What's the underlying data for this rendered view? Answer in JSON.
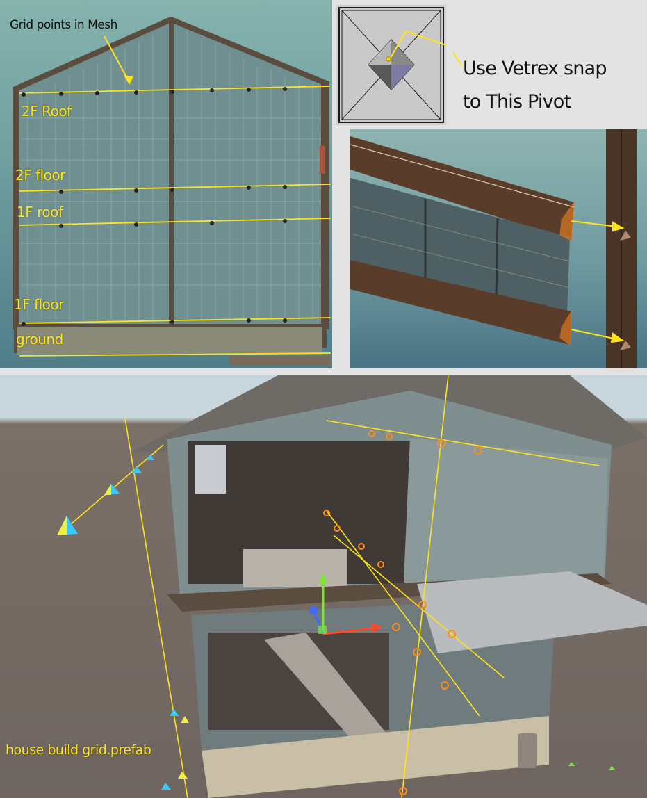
{
  "elevation_panel": {
    "annotation": "Grid points in Mesh",
    "levels": [
      "2F Roof",
      "2F floor",
      "1F roof",
      "1F floor",
      "ground"
    ]
  },
  "pivot_note": {
    "line1": "Use Vetrex snap",
    "line2": "to This Pivot"
  },
  "scene_panel": {
    "prefab_name": "house build grid.prefab"
  },
  "colors": {
    "annotation_yellow": "#ffe31a",
    "snap_orange": "#ff8a1e",
    "scene_ground": "#6e6560",
    "sky_teal": "#7aa9a8"
  },
  "icons": [
    "pivot-pyramid-icon",
    "arrow-icon",
    "move-gizmo-icon"
  ]
}
